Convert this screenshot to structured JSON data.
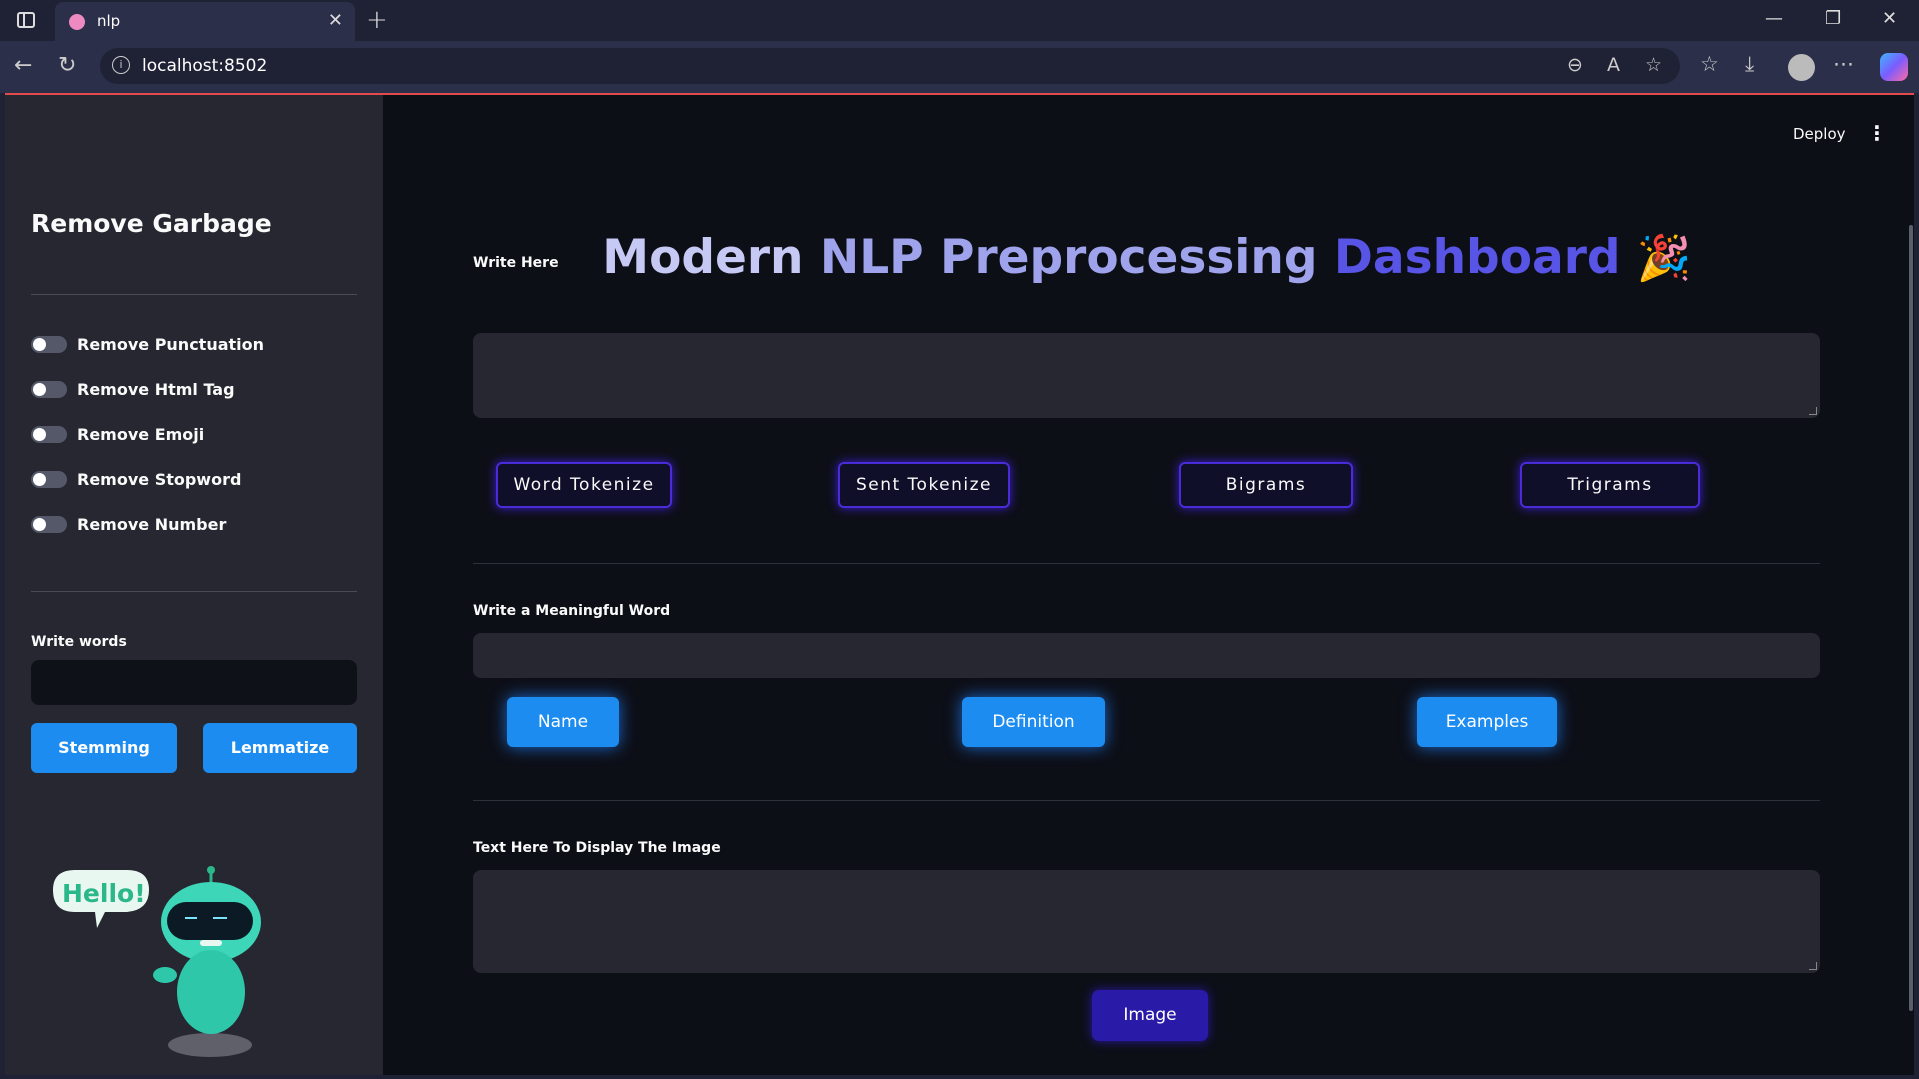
{
  "browser": {
    "tab_title": "nlp",
    "url": "localhost:8502"
  },
  "sidebar": {
    "title": "Remove Garbage",
    "toggles": [
      {
        "label": "Remove Punctuation",
        "on": false
      },
      {
        "label": "Remove Html Tag",
        "on": false
      },
      {
        "label": "Remove Emoji",
        "on": false
      },
      {
        "label": "Remove Stopword",
        "on": false
      },
      {
        "label": "Remove Number",
        "on": false
      }
    ],
    "words_label": "Write words",
    "words_value": "",
    "stemming_label": "Stemming",
    "lemmatize_label": "Lemmatize",
    "robot_bubble": "Hello!"
  },
  "header": {
    "deploy_label": "Deploy"
  },
  "main": {
    "headline_words": [
      "Modern",
      "NLP",
      "Preprocessing",
      "Dashboard"
    ],
    "headline_emoji": "🎉",
    "write_here_label": "Write Here",
    "write_here_value": "",
    "token_buttons": [
      "Word Tokenize",
      "Sent Tokenize",
      "Bigrams",
      "Trigrams"
    ],
    "meaningful_label": "Write a Meaningful Word",
    "meaningful_value": "",
    "word_buttons": [
      "Name",
      "Definition",
      "Examples"
    ],
    "image_text_label": "Text Here To Display The Image",
    "image_text_value": "",
    "image_button": "Image"
  },
  "colors": {
    "accent_blue": "#1c8cf0",
    "accent_purple": "#4a2bd8",
    "image_button": "#2a1aa8",
    "app_bg": "#0d0f17",
    "sidebar_bg": "#262730"
  }
}
